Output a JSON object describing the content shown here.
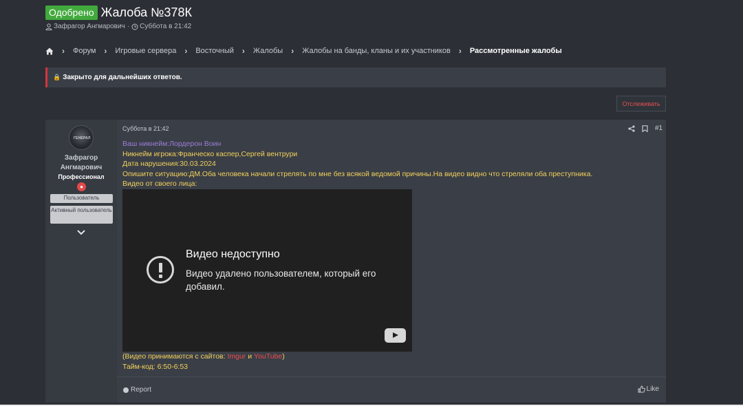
{
  "thread": {
    "badge": "Одобрено",
    "title": "Жалоба №378К",
    "author": "Зафрагор Ангмарович",
    "date": "Суббота в 21:42",
    "separator": "·"
  },
  "breadcrumbs": [
    "Форум",
    "Игровые сервера",
    "Восточный",
    "Жалобы",
    "Жалобы на банды, кланы и их участников",
    "Рассмотренные жалобы"
  ],
  "notice": {
    "text": "Закрыто для дальнейших ответов."
  },
  "watch_button": {
    "label": "Отслеживать"
  },
  "post": {
    "user": {
      "name_line1": "Зафрагор",
      "name_line2": "Ангмарович",
      "rank": "Профессионал",
      "badges": [
        "Пользователь",
        "Активный пользователь"
      ],
      "avatar_text": "ГЕНЕРАЛ"
    },
    "date": "Суббота в 21:42",
    "number": "#1",
    "lines": {
      "nickname": "Ваш никнейм:Лордерон Воин",
      "player": "Никнейм игрока:Франческо каспер,Сергей вентрури",
      "date": "Дата нарушения:30.03.2024",
      "situation": "Опишите ситуацию:ДМ.Оба человека начали стрелять по мне без всякой ведомой причины.На видео видно что стреляли оба преступника.",
      "video_label": "Видео от своего лица:"
    },
    "video": {
      "title": "Видео недоступно",
      "subtitle": "Видео удалено пользователем, который его добавил."
    },
    "after": {
      "prefix": "(Видео принимаются с сайтов: ",
      "site1": "Imgur",
      "and": " и ",
      "site2": "YouTube",
      "suffix": ")",
      "timecode": "Тайм-код: 6:50-6:53"
    },
    "footer": {
      "report": "Report",
      "like": "Like"
    }
  },
  "colors": {
    "approved": "#42a93d",
    "accent_red": "#e34a4a",
    "post_yellow": "#f2d25c",
    "post_purple": "#9b7fd9"
  }
}
